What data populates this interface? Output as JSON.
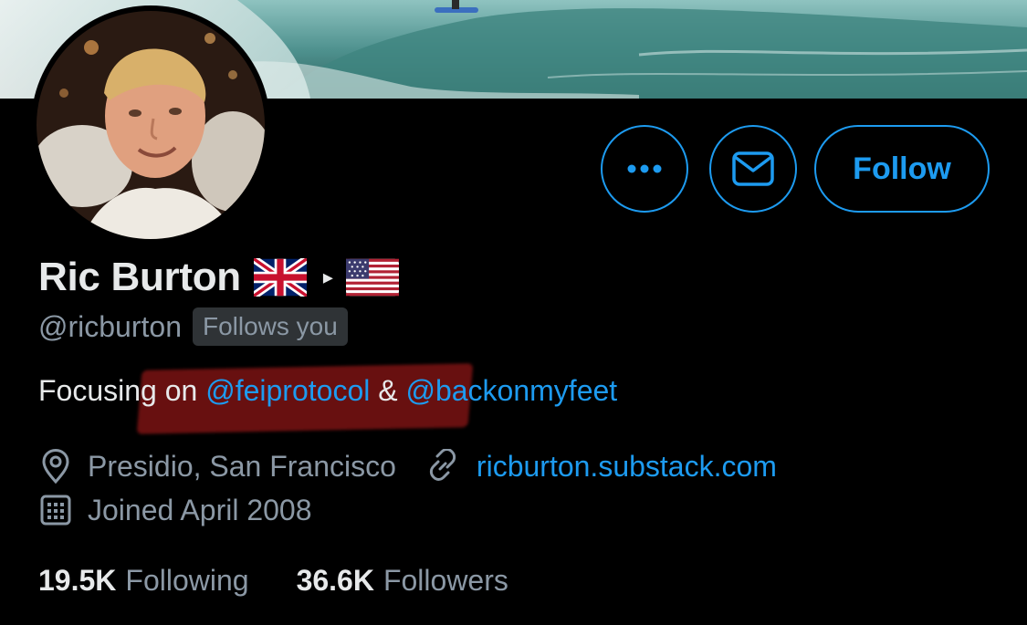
{
  "profile": {
    "display_name": "Ric Burton",
    "handle": "@ricburton",
    "follows_you_badge": "Follows you",
    "flags": [
      "uk-flag",
      "us-flag"
    ],
    "arrow": "▸"
  },
  "actions": {
    "more_icon": "more-horizontal-icon",
    "message_icon": "mail-icon",
    "follow_label": "Follow"
  },
  "bio": {
    "prefix": "Focusing on ",
    "mention_1": "@feiprotocol",
    "joiner": " & ",
    "mention_2": "@backonmyfeet"
  },
  "meta": {
    "location": "Presidio, San Francisco",
    "website": "ricburton.substack.com",
    "joined": "Joined April 2008"
  },
  "stats": {
    "following_count": "19.5K",
    "following_label": "Following",
    "followers_count": "36.6K",
    "followers_label": "Followers"
  },
  "colors": {
    "accent": "#1d9bf0",
    "background": "#000000",
    "secondary_text": "#8b98a5",
    "primary_text": "#e7e9ea"
  }
}
